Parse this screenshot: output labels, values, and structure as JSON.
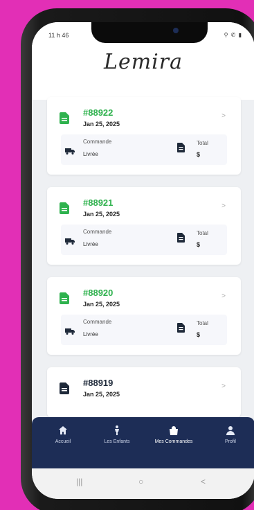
{
  "status": {
    "time": "11 h 46",
    "icons": "⚲ ✆ ▮"
  },
  "app": {
    "brand": "Lemira"
  },
  "orders": [
    {
      "number": "#88922",
      "date": "Jan 25, 2025",
      "label": "Commande",
      "status": "Livrée",
      "total_label": "Total",
      "currency": "$",
      "accent": "#2fb24e"
    },
    {
      "number": "#88921",
      "date": "Jan 25, 2025",
      "label": "Commande",
      "status": "Livrée",
      "total_label": "Total",
      "currency": "$",
      "accent": "#2fb24e"
    },
    {
      "number": "#88920",
      "date": "Jan 25, 2025",
      "label": "Commande",
      "status": "Livrée",
      "total_label": "Total",
      "currency": "$",
      "accent": "#2fb24e"
    },
    {
      "number": "#88919",
      "date": "Jan 25, 2025",
      "accent": "#1f2a3a"
    }
  ],
  "nav": {
    "items": [
      {
        "label": "Accueil",
        "icon": "home-icon"
      },
      {
        "label": "Les Enfants",
        "icon": "person-icon"
      },
      {
        "label": "Mes Commandes",
        "icon": "shopping-bag-icon",
        "active": true
      },
      {
        "label": "Profil",
        "icon": "user-icon"
      }
    ]
  },
  "system_nav": {
    "recent": "|||",
    "home": "○",
    "back": "<"
  }
}
